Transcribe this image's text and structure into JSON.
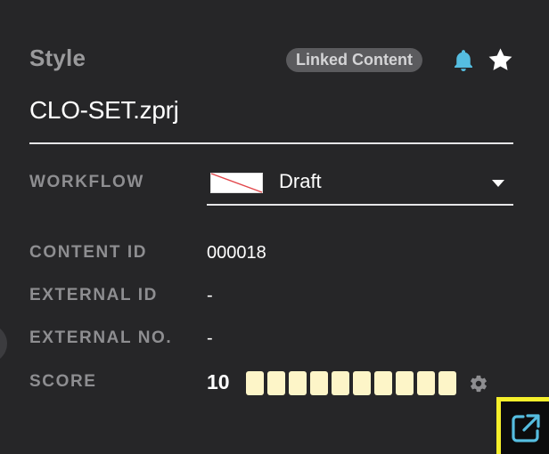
{
  "header": {
    "section_label": "Style",
    "badge_label": "Linked Content",
    "bell_icon": "bell-icon",
    "star_icon": "star-icon",
    "file_name": "CLO-SET.zprj"
  },
  "fields": {
    "workflow": {
      "label": "WORKFLOW",
      "value": "Draft",
      "swatch_icon": "no-color-swatch-icon",
      "caret_icon": "caret-down-icon"
    },
    "content_id": {
      "label": "CONTENT ID",
      "value": "000018"
    },
    "external_id": {
      "label": "EXTERNAL ID",
      "value": "-"
    },
    "external_no": {
      "label": "EXTERNAL NO.",
      "value": "-"
    },
    "score": {
      "label": "SCORE",
      "value": "10",
      "max": 10,
      "filled": 10,
      "gear_icon": "gear-icon"
    }
  },
  "actions": {
    "popout_icon": "open-external-icon"
  },
  "colors": {
    "panel_bg": "#262628",
    "label_gray": "#8e8e91",
    "badge_bg": "#5b5b5e",
    "accent_blue": "#55bde0",
    "score_fill": "#fdf5c8",
    "highlight_yellow": "#f5ef2b"
  }
}
